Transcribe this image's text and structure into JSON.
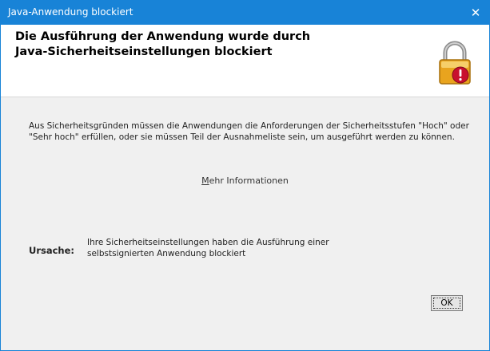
{
  "window": {
    "title": "Java-Anwendung blockiert",
    "close_glyph": "✕"
  },
  "header": {
    "title_line1": "Die Ausführung der Anwendung wurde durch",
    "title_line2": "Java-Sicherheitseinstellungen blockiert",
    "icon": "lock-warning-icon"
  },
  "body": {
    "message": "Aus Sicherheitsgründen müssen die Anwendungen die Anforderungen der Sicherheitsstufen \"Hoch\" oder \"Sehr hoch\" erfüllen, oder sie müssen Teil der Ausnahmeliste sein, um ausgeführt werden zu können.",
    "more_info_accesskey": "M",
    "more_info_rest": "ehr Informationen",
    "cause_label": "Ursache:",
    "cause_text": "Ihre Sicherheitseinstellungen haben die Ausführung einer selbstsignierten Anwendung blockiert"
  },
  "buttons": {
    "ok_label": "OK"
  },
  "colors": {
    "titlebar": "#1883d7",
    "lock_body": "#e9a41e",
    "warning": "#c8102e"
  }
}
